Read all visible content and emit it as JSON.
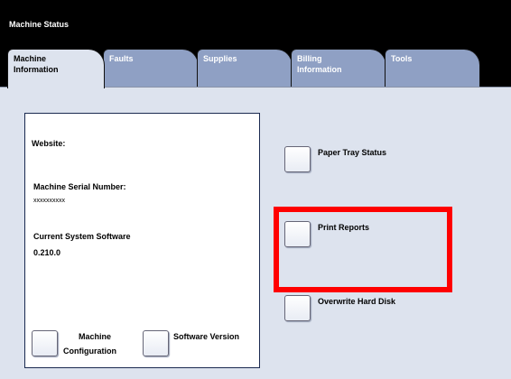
{
  "window": {
    "title": "Machine Status"
  },
  "tabs": [
    {
      "line1": "Machine",
      "line2": "Information"
    },
    {
      "line1": "Faults",
      "line2": ""
    },
    {
      "line1": "Supplies",
      "line2": ""
    },
    {
      "line1": "Billing",
      "line2": "Information"
    },
    {
      "line1": "Tools",
      "line2": ""
    }
  ],
  "info": {
    "website_label": "Website:",
    "serial_label": "Machine Serial Number:",
    "serial_value": "xxxxxxxxxx",
    "software_label": "Current System Software",
    "software_value": "0.210.0"
  },
  "buttons": {
    "machine_config": {
      "line1": "Machine",
      "line2": "Configuration"
    },
    "software_version": "Software Version",
    "paper_tray_status": "Paper Tray Status",
    "print_reports": "Print Reports",
    "overwrite_hard_disk": "Overwrite Hard Disk"
  },
  "colors": {
    "active_tab": "#dde3ee",
    "inactive_tab": "#8fa0c4",
    "highlight": "#ff0000"
  }
}
